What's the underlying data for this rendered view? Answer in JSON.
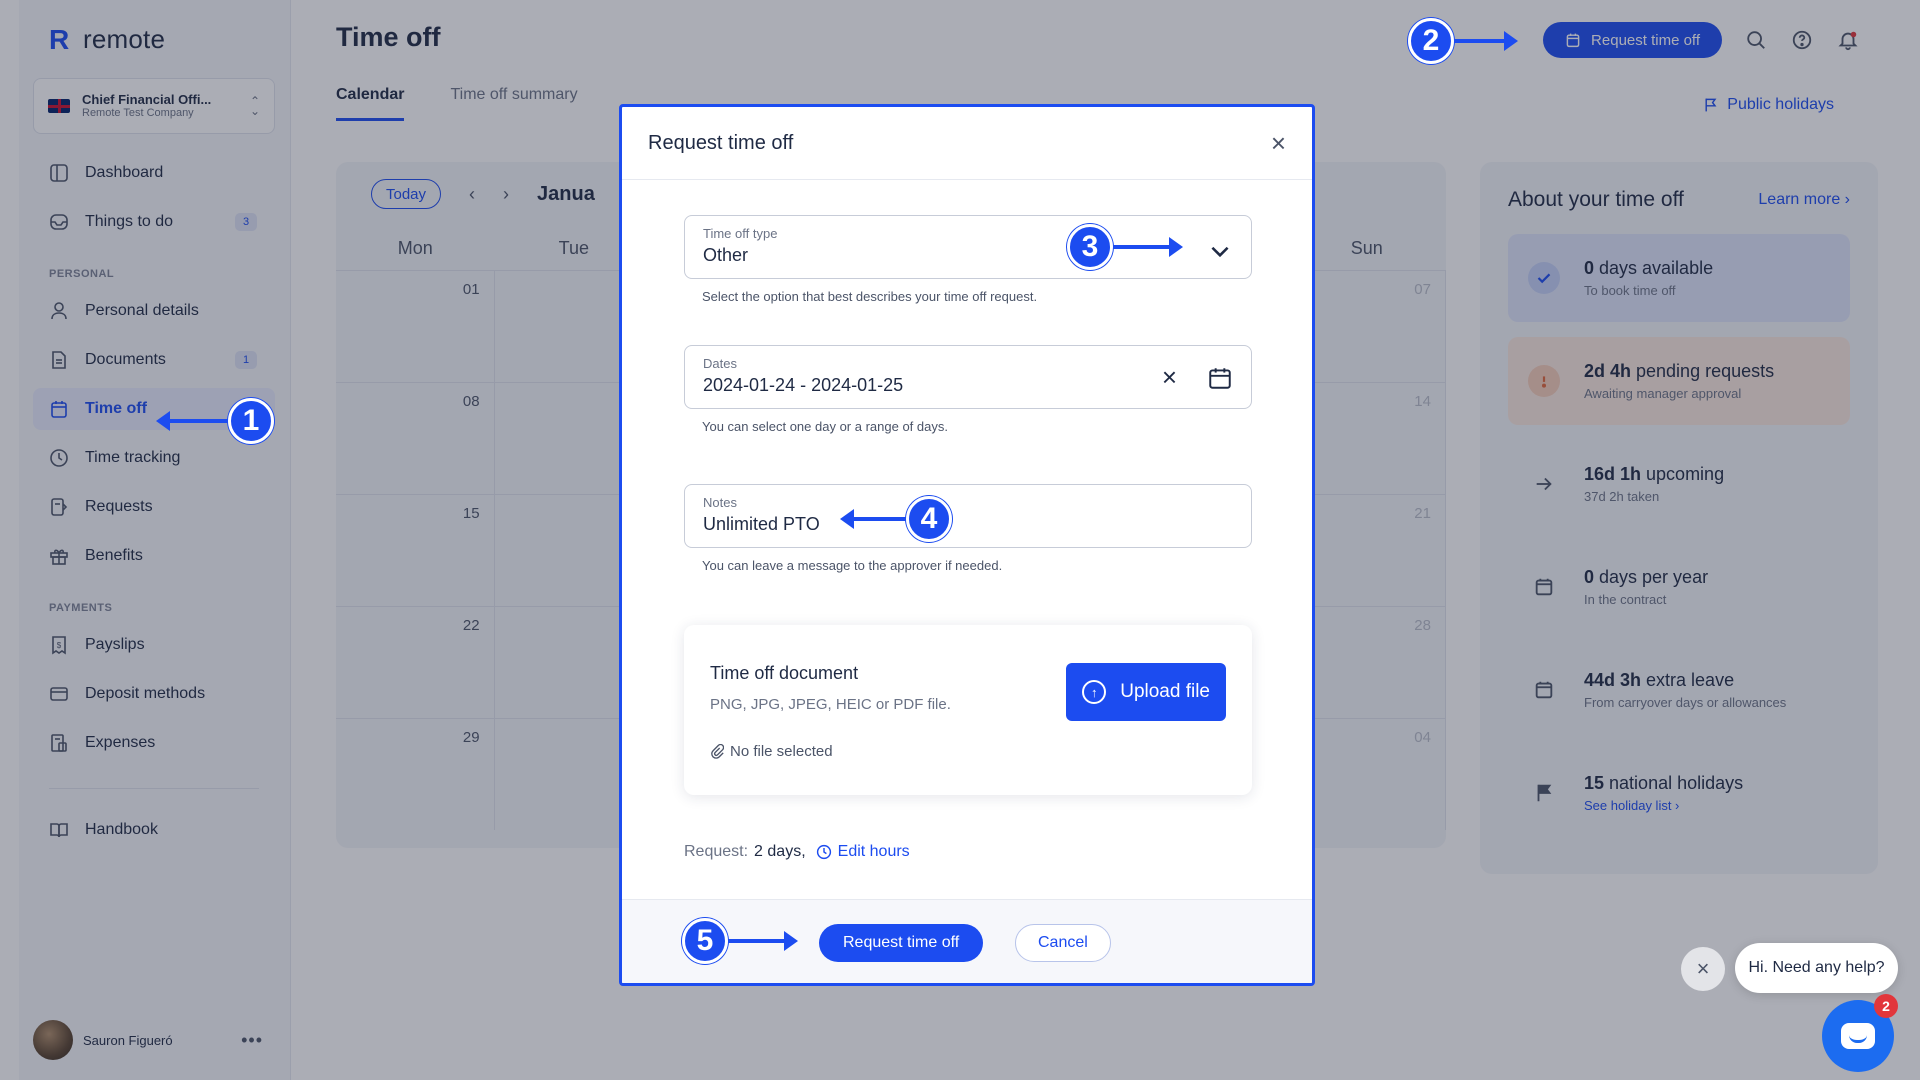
{
  "app": {
    "logo_text": "remote"
  },
  "company": {
    "name": "Chief Financial Offi...",
    "sub": "Remote Test Company"
  },
  "sidebar": {
    "items_top": [
      {
        "label": "Dashboard"
      },
      {
        "label": "Things to do",
        "badge": "3"
      }
    ],
    "section_personal": "PERSONAL",
    "items_personal": [
      {
        "label": "Personal details"
      },
      {
        "label": "Documents",
        "badge": "1"
      },
      {
        "label": "Time off"
      },
      {
        "label": "Time tracking"
      },
      {
        "label": "Requests"
      },
      {
        "label": "Benefits"
      }
    ],
    "section_payments": "PAYMENTS",
    "items_payments": [
      {
        "label": "Payslips"
      },
      {
        "label": "Deposit methods"
      },
      {
        "label": "Expenses"
      }
    ],
    "items_bottom": [
      {
        "label": "Handbook"
      }
    ],
    "user_name": "Sauron Figueró",
    "user_menu": "•••"
  },
  "header": {
    "title": "Time off",
    "tabs": [
      {
        "label": "Calendar"
      },
      {
        "label": "Time off summary"
      }
    ],
    "request_button": "Request time off",
    "public_holidays": "Public holidays"
  },
  "calendar": {
    "today": "Today",
    "prev": "‹",
    "next": "›",
    "month": "Janua",
    "weekdays": [
      "Mon",
      "Tue",
      "",
      "",
      "",
      "",
      "Sun"
    ],
    "rows": [
      [
        "01",
        "",
        "",
        "",
        "",
        "",
        "07"
      ],
      [
        "08",
        "",
        "",
        "",
        "",
        "",
        "14"
      ],
      [
        "15",
        "",
        "",
        "",
        "",
        "",
        "21"
      ],
      [
        "22",
        "",
        "",
        "",
        "",
        "",
        "28"
      ],
      [
        "29",
        "",
        "",
        "",
        "",
        "",
        "04"
      ]
    ]
  },
  "about": {
    "title": "About your time off",
    "learn_more": "Learn more ›",
    "stats": [
      {
        "value": "0",
        "text": " days available",
        "sub": "To book time off"
      },
      {
        "value": "2d 4h",
        "text": " pending requests",
        "sub": "Awaiting manager approval"
      },
      {
        "value": "16d 1h",
        "text": " upcoming",
        "sub": "37d 2h taken"
      },
      {
        "value": "0",
        "text": " days per year",
        "sub": "In the contract"
      },
      {
        "value": "44d 3h",
        "text": " extra leave",
        "sub": "From carryover days or allowances"
      },
      {
        "value": "15",
        "text": " national holidays",
        "sub": "See holiday list ›"
      }
    ]
  },
  "modal": {
    "title": "Request time off",
    "close": "×",
    "type_label": "Time off type",
    "type_value": "Other",
    "type_hint": "Select the option that best describes your time off request.",
    "dates_label": "Dates",
    "dates_value": "2024-01-24 - 2024-01-25",
    "dates_clear": "×",
    "dates_hint": "You can select one day or a range of days.",
    "notes_label": "Notes",
    "notes_value": "Unlimited PTO",
    "notes_hint": "You can leave a message to the approver if needed.",
    "doc_title": "Time off document",
    "doc_sub": "PNG, JPG, JPEG, HEIC or PDF file.",
    "doc_none": "No file selected",
    "upload": "Upload file",
    "request_label": "Request:",
    "request_value": "2 days,",
    "edit_hours": "Edit hours",
    "submit": "Request time off",
    "cancel": "Cancel"
  },
  "markers": [
    "1",
    "2",
    "3",
    "4",
    "5"
  ],
  "chat": {
    "close": "×",
    "message": "Hi. Need any help?",
    "count": "2"
  },
  "colors": {
    "accent": "#1c4cf0",
    "overlay": "rgba(34,40,60,0.38)"
  }
}
